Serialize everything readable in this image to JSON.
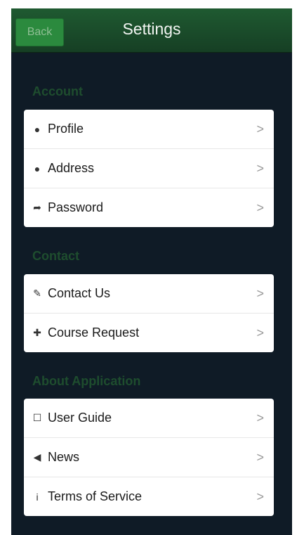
{
  "header": {
    "back_label": "Back",
    "title": "Settings"
  },
  "sections": [
    {
      "title": "Account",
      "items": [
        {
          "label": "Profile",
          "icon": "globe-icon",
          "glyph": "●"
        },
        {
          "label": "Address",
          "icon": "globe-icon",
          "glyph": "●"
        },
        {
          "label": "Password",
          "icon": "share-icon",
          "glyph": "➦"
        }
      ]
    },
    {
      "title": "Contact",
      "items": [
        {
          "label": "Contact Us",
          "icon": "pencil-icon",
          "glyph": "✎"
        },
        {
          "label": "Course Request",
          "icon": "plus-icon",
          "glyph": "✚"
        }
      ]
    },
    {
      "title": "About Application",
      "items": [
        {
          "label": "User Guide",
          "icon": "book-icon",
          "glyph": "☐"
        },
        {
          "label": "News",
          "icon": "speaker-icon",
          "glyph": "◀"
        },
        {
          "label": "Terms of Service",
          "icon": "info-icon",
          "glyph": "i"
        }
      ]
    }
  ],
  "chevron": ">"
}
